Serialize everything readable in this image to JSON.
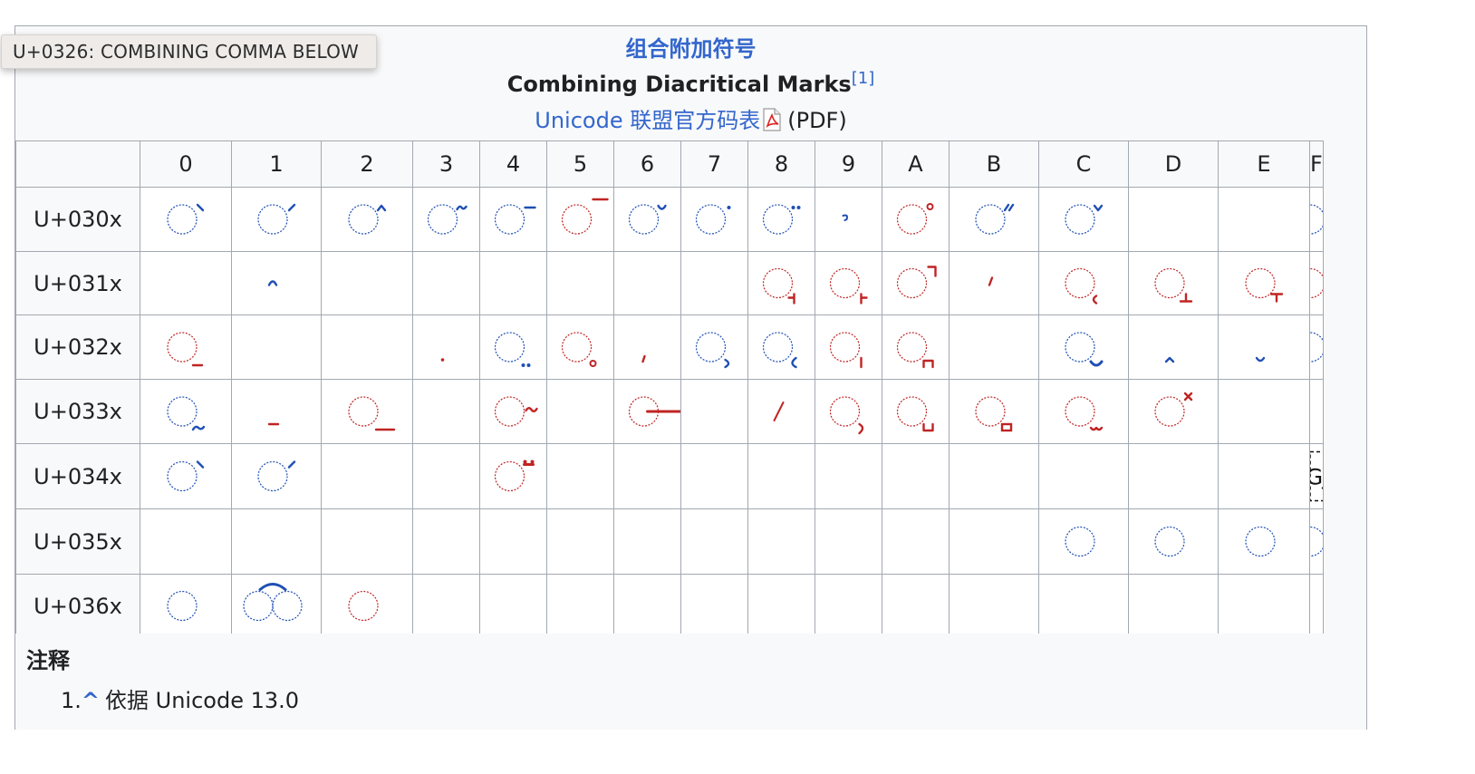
{
  "header": {
    "title_cn": "组合附加符号",
    "title_en": "Combining Diacritical Marks",
    "ref_mark": "[1]",
    "source_link": "Unicode 联盟官方码表",
    "source_note": "(PDF)"
  },
  "grid": {
    "columns": [
      "0",
      "1",
      "2",
      "3",
      "4",
      "5",
      "6",
      "7",
      "8",
      "9",
      "A",
      "B",
      "C",
      "D",
      "E",
      "F"
    ],
    "rows": [
      {
        "label": "U+030x",
        "cells": [
          {
            "c": "b",
            "m": "grave"
          },
          {
            "c": "b",
            "m": "acute"
          },
          {
            "c": "b",
            "m": "circ"
          },
          {
            "c": "b",
            "m": "tilde"
          },
          {
            "c": "b",
            "m": "macron"
          },
          {
            "c": "r",
            "m": "overline"
          },
          {
            "c": "b",
            "m": "breve"
          },
          {
            "c": "b",
            "m": "dot"
          },
          {
            "c": "b",
            "m": "diaer"
          },
          {
            "c": "b",
            "m": "hook"
          },
          {
            "c": "r",
            "m": "ring"
          },
          {
            "c": "b",
            "m": "dacute"
          },
          {
            "c": "b",
            "m": "caron"
          },
          null,
          null,
          {
            "c": "b",
            "m": "dvert"
          }
        ]
      },
      {
        "label": "U+031x",
        "cells": [
          null,
          {
            "c": "b",
            "m": "invbreve_s"
          },
          null,
          null,
          null,
          null,
          null,
          null,
          {
            "c": "r",
            "m": "lefttack"
          },
          {
            "c": "r",
            "m": "righttack"
          },
          {
            "c": "r",
            "m": "corner"
          },
          {
            "c": "r",
            "m": "comma_s"
          },
          {
            "c": "r",
            "m": "hookbelow"
          },
          {
            "c": "r",
            "m": "uptack"
          },
          {
            "c": "r",
            "m": "downtack"
          },
          {
            "c": "r",
            "m": "plus"
          }
        ]
      },
      {
        "label": "U+032x",
        "cells": [
          {
            "c": "r",
            "m": "minusbelow"
          },
          null,
          null,
          {
            "c": "r",
            "m": "dotbelow_s"
          },
          {
            "c": "b",
            "m": "diaerbelow"
          },
          {
            "c": "r",
            "m": "ringbelow"
          },
          {
            "c": "r",
            "m": "commabelow_s"
          },
          {
            "c": "b",
            "m": "cedilla"
          },
          {
            "c": "b",
            "m": "ogonek"
          },
          {
            "c": "r",
            "m": "vertbelow"
          },
          {
            "c": "r",
            "m": "bridge"
          },
          null,
          {
            "c": "b",
            "m": "caronbelow"
          },
          {
            "c": "b",
            "m": "circbelow_s"
          },
          {
            "c": "b",
            "m": "brevebelow_s"
          },
          {
            "c": "b",
            "m": "invbrevebelow"
          }
        ]
      },
      {
        "label": "U+033x",
        "cells": [
          {
            "c": "b",
            "m": "tildebelow"
          },
          {
            "c": "r",
            "m": "macronbelow_s"
          },
          {
            "c": "r",
            "m": "lowline"
          },
          null,
          {
            "c": "r",
            "m": "tildeover"
          },
          null,
          {
            "c": "r",
            "m": "longstroke"
          },
          null,
          {
            "c": "r",
            "m": "slash_s"
          },
          {
            "c": "r",
            "m": "halfring"
          },
          {
            "c": "r",
            "m": "bridgebelow"
          },
          {
            "c": "r",
            "m": "square"
          },
          {
            "c": "r",
            "m": "seagull"
          },
          {
            "c": "r",
            "m": "xabove"
          },
          null,
          null
        ]
      },
      {
        "label": "U+034x",
        "cells": [
          {
            "c": "b",
            "m": "grave"
          },
          {
            "c": "b",
            "m": "acute"
          },
          null,
          null,
          {
            "c": "r",
            "m": "dialytika"
          },
          null,
          null,
          null,
          null,
          null,
          null,
          null,
          null,
          null,
          null,
          {
            "c": "k",
            "m": "cgj",
            "t": "CGJ"
          }
        ]
      },
      {
        "label": "U+035x",
        "cells": [
          null,
          null,
          null,
          null,
          null,
          null,
          null,
          null,
          null,
          null,
          null,
          null,
          {
            "c": "b",
            "m": "plain"
          },
          {
            "c": "b",
            "m": "plain"
          },
          {
            "c": "b",
            "m": "plain"
          },
          {
            "c": "b",
            "m": "plain"
          }
        ]
      },
      {
        "label": "U+036x",
        "cells": [
          {
            "c": "b",
            "m": "plain"
          },
          {
            "c": "b",
            "m": "double"
          },
          {
            "c": "r",
            "m": "plain"
          },
          null,
          null,
          null,
          null,
          null,
          null,
          null,
          null,
          null,
          null,
          null,
          null,
          null
        ]
      }
    ]
  },
  "colors": {
    "blue": "#1f4fb4",
    "red": "#c02424",
    "link": "#3366cc"
  },
  "notes": {
    "title": "注释",
    "items": [
      {
        "num": "1.",
        "back": "^",
        "text": "依据 Unicode 13.0"
      }
    ]
  },
  "tooltip": {
    "text": "U+0326: COMBINING COMMA BELOW"
  },
  "icons": {
    "pdf": "pdf-file-icon"
  }
}
